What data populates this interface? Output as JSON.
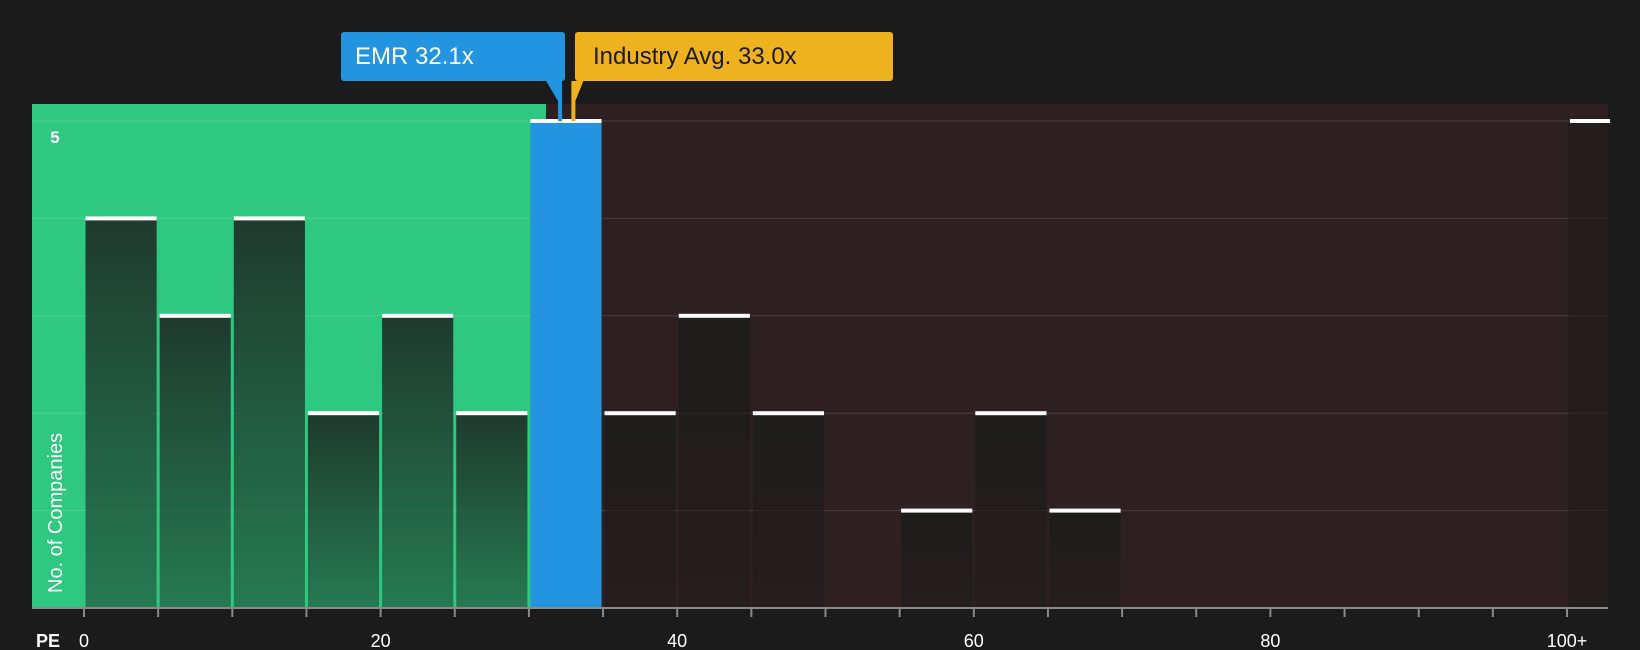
{
  "colors": {
    "background": "#1b1b1b",
    "undervalued_zone": "#2ec880",
    "overvalued_zone": "#2e1f20",
    "company_bar": "#2394e0",
    "industry_marker": "#eeb21e",
    "bar_cap": "#ffffff"
  },
  "callouts": {
    "company": "EMR 32.1x",
    "industry": "Industry Avg. 33.0x"
  },
  "chart_data": {
    "type": "bar",
    "xlabel": "PE",
    "ylabel": "No. of Companies",
    "xlim": [
      0,
      100
    ],
    "ylim": [
      0,
      5
    ],
    "y_tick_labels": [
      {
        "value": 5,
        "label": "5"
      }
    ],
    "x_tick_labels": [
      {
        "value": 0,
        "label": "0"
      },
      {
        "value": 20,
        "label": "20"
      },
      {
        "value": 40,
        "label": "40"
      },
      {
        "value": 60,
        "label": "60"
      },
      {
        "value": 80,
        "label": "80"
      },
      {
        "value": 100,
        "label": "100+"
      }
    ],
    "bin_width": 5,
    "bins": [
      {
        "start": 0,
        "count": 4
      },
      {
        "start": 5,
        "count": 3
      },
      {
        "start": 10,
        "count": 4
      },
      {
        "start": 15,
        "count": 2
      },
      {
        "start": 20,
        "count": 3
      },
      {
        "start": 25,
        "count": 2
      },
      {
        "start": 30,
        "count": 5,
        "highlight": true
      },
      {
        "start": 35,
        "count": 2
      },
      {
        "start": 40,
        "count": 3
      },
      {
        "start": 45,
        "count": 2
      },
      {
        "start": 50,
        "count": 0
      },
      {
        "start": 55,
        "count": 1
      },
      {
        "start": 60,
        "count": 2
      },
      {
        "start": 65,
        "count": 1
      },
      {
        "start": 70,
        "count": 0
      },
      {
        "start": 75,
        "count": 0
      },
      {
        "start": 80,
        "count": 0
      },
      {
        "start": 85,
        "count": 0
      },
      {
        "start": 90,
        "count": 0
      },
      {
        "start": 95,
        "count": 0
      },
      {
        "start": 100,
        "count": 5
      }
    ],
    "company": {
      "name": "EMR",
      "value": 32.1
    },
    "industry_average": 33.0,
    "undervalued_zone_end": 31.5
  }
}
